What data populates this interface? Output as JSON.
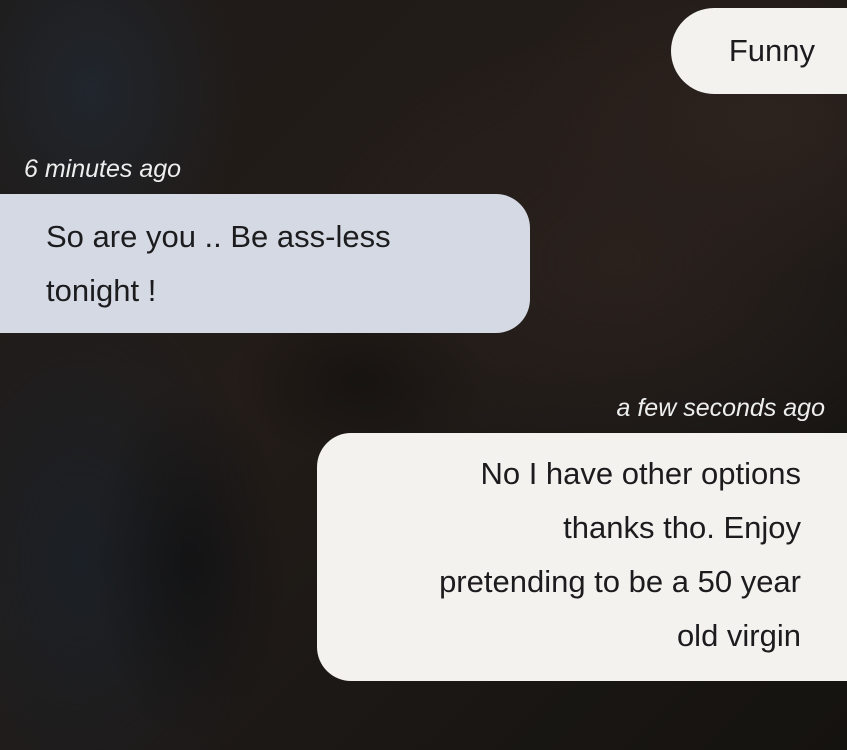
{
  "conversation": {
    "messages": [
      {
        "direction": "sent",
        "lines": [
          "Funny"
        ]
      },
      {
        "direction": "received",
        "timestamp": "6 minutes ago",
        "lines": [
          "So are you .. Be ass-less",
          "tonight !"
        ]
      },
      {
        "direction": "sent",
        "timestamp": "a few seconds ago",
        "lines": [
          "No I have other options",
          "thanks tho. Enjoy",
          "pretending to be a 50 year",
          "old virgin"
        ]
      }
    ]
  },
  "colors": {
    "sent_bubble": "#f3f2ef",
    "received_bubble": "#d4d9e3",
    "text": "#1c1c1e",
    "timestamp": "#eeeeee"
  }
}
